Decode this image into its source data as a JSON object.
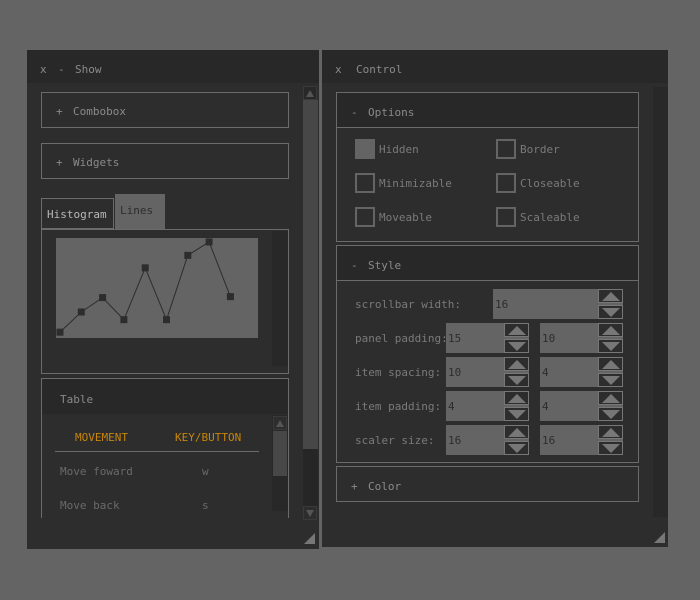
{
  "show_window": {
    "close_glyph": "x",
    "minimize_glyph": "-",
    "title": "Show",
    "sections": [
      {
        "toggle": "+",
        "label": "Combobox"
      },
      {
        "toggle": "+",
        "label": "Widgets"
      }
    ],
    "tabs": [
      {
        "label": "Histogram",
        "active": false
      },
      {
        "label": "Lines",
        "active": true
      }
    ],
    "table": {
      "title": "Table",
      "columns": [
        "MOVEMENT",
        "KEY/BUTTON"
      ],
      "rows": [
        {
          "movement": "Move foward",
          "key": "w"
        },
        {
          "movement": "Move back",
          "key": "s"
        }
      ]
    },
    "scroll": {
      "up": "▲",
      "down": "▼"
    }
  },
  "chart_data": {
    "type": "line",
    "title": "",
    "xlabel": "",
    "ylabel": "",
    "x": [
      0,
      1,
      2,
      3,
      4,
      5,
      6,
      7,
      8
    ],
    "values": [
      0.04,
      0.25,
      0.4,
      0.17,
      0.71,
      0.17,
      0.84,
      0.98,
      0.41
    ],
    "ylim": [
      0,
      1
    ],
    "grid": false,
    "colors": {
      "background": "#646464",
      "line": "#2d2d2d",
      "marker": "#2d2d2d"
    }
  },
  "control_window": {
    "close_glyph": "x",
    "title": "Control",
    "options": {
      "toggle": "-",
      "label": "Options",
      "checkboxes": [
        {
          "label": "Hidden",
          "checked": true
        },
        {
          "label": "Border",
          "checked": false
        },
        {
          "label": "Minimizable",
          "checked": false
        },
        {
          "label": "Closeable",
          "checked": false
        },
        {
          "label": "Moveable",
          "checked": false
        },
        {
          "label": "Scaleable",
          "checked": false
        }
      ]
    },
    "style": {
      "toggle": "-",
      "label": "Style",
      "scrollbar_width": {
        "label": "scrollbar width:",
        "value": "16"
      },
      "rows": [
        {
          "label": "panel padding:",
          "a": "15",
          "b": "10"
        },
        {
          "label": "item spacing:",
          "a": "10",
          "b": "4"
        },
        {
          "label": "item padding:",
          "a": "4",
          "b": "4"
        },
        {
          "label": "scaler size:",
          "a": "16",
          "b": "16"
        }
      ]
    },
    "color": {
      "toggle": "+",
      "label": "Color"
    }
  },
  "colors": {
    "accent_header": "#c8860b",
    "background": "#646464",
    "window": "#2d2d2d"
  }
}
